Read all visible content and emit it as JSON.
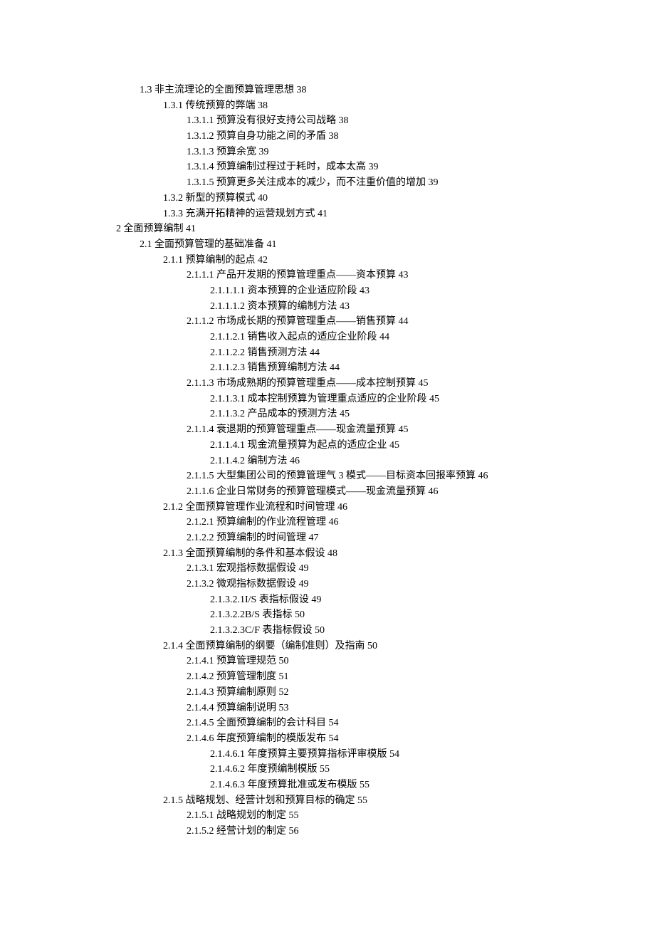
{
  "toc": [
    {
      "level": 0,
      "text": "1.3 非主流理论的全面预算管理思想 38"
    },
    {
      "level": 1,
      "text": "1.3.1 传统预算的弊端 38"
    },
    {
      "level": 2,
      "text": "1.3.1.1 预算没有很好支持公司战略 38"
    },
    {
      "level": 2,
      "text": "1.3.1.2 预算自身功能之间的矛盾 38"
    },
    {
      "level": 2,
      "text": "1.3.1.3 预算余宽 39"
    },
    {
      "level": 2,
      "text": "1.3.1.4 预算编制过程过于耗时，成本太高 39"
    },
    {
      "level": 2,
      "text": "1.3.1.5 预算更多关注成本的减少，而不注重价值的增加 39"
    },
    {
      "level": 1,
      "text": "1.3.2 新型的预算模式 40"
    },
    {
      "level": 1,
      "text": "1.3.3 充满开拓精神的运营规划方式 41"
    },
    {
      "level": -1,
      "text": "2 全面预算编制 41"
    },
    {
      "level": 0,
      "text": "2.1 全面预算管理的基础准备 41"
    },
    {
      "level": 1,
      "text": "2.1.1 预算编制的起点 42"
    },
    {
      "level": 2,
      "text": "2.1.1.1 产品开发期的预算管理重点——资本预算 43"
    },
    {
      "level": 3,
      "text": "2.1.1.1.1 资本预算的企业适应阶段 43"
    },
    {
      "level": 3,
      "text": "2.1.1.1.2 资本预算的编制方法 43"
    },
    {
      "level": 2,
      "text": "2.1.1.2 市场成长期的预算管理重点——销售预算 44"
    },
    {
      "level": 3,
      "text": "2.1.1.2.1 销售收入起点的适应企业阶段 44"
    },
    {
      "level": 3,
      "text": "2.1.1.2.2 销售预测方法 44"
    },
    {
      "level": 3,
      "text": "2.1.1.2.3 销售预算编制方法 44"
    },
    {
      "level": 2,
      "text": "2.1.1.3 市场成熟期的预算管理重点——成本控制预算 45"
    },
    {
      "level": 3,
      "text": "2.1.1.3.1 成本控制预算为管理重点适应的企业阶段 45"
    },
    {
      "level": 3,
      "text": "2.1.1.3.2 产品成本的预测方法 45"
    },
    {
      "level": 2,
      "text": "2.1.1.4 衰退期的预算管理重点——现金流量预算 45"
    },
    {
      "level": 3,
      "text": "2.1.1.4.1 现金流量预算为起点的适应企业 45"
    },
    {
      "level": 3,
      "text": "2.1.1.4.2 编制方法 46"
    },
    {
      "level": 2,
      "text": "2.1.1.5 大型集团公司的预算管理气 3 模式——目标资本回报率预算 46"
    },
    {
      "level": 2,
      "text": "2.1.1.6 企业日常财务的预算管理模式——现金流量预算 46"
    },
    {
      "level": 1,
      "text": "2.1.2 全面预算管理作业流程和时间管理 46"
    },
    {
      "level": 2,
      "text": "2.1.2.1 预算编制的作业流程管理 46"
    },
    {
      "level": 2,
      "text": "2.1.2.2 预算编制的时间管理 47"
    },
    {
      "level": 1,
      "text": "2.1.3 全面预算编制的条件和基本假设 48"
    },
    {
      "level": 2,
      "text": "2.1.3.1 宏观指标数据假设 49"
    },
    {
      "level": 2,
      "text": "2.1.3.2 微观指标数据假设 49"
    },
    {
      "level": 3,
      "text": "2.1.3.2.1I/S 表指标假设 49"
    },
    {
      "level": 3,
      "text": "2.1.3.2.2B/S 表指标 50"
    },
    {
      "level": 3,
      "text": "2.1.3.2.3C/F 表指标假设 50"
    },
    {
      "level": 1,
      "text": "2.1.4 全面预算编制的纲要（编制准则）及指南 50"
    },
    {
      "level": 2,
      "text": "2.1.4.1 预算管理规范 50"
    },
    {
      "level": 2,
      "text": "2.1.4.2 预算管理制度 51"
    },
    {
      "level": 2,
      "text": "2.1.4.3 预算编制原则 52"
    },
    {
      "level": 2,
      "text": "2.1.4.4 预算编制说明 53"
    },
    {
      "level": 2,
      "text": "2.1.4.5 全面预算编制的会计科目 54"
    },
    {
      "level": 2,
      "text": "2.1.4.6 年度预算编制的模版发布 54"
    },
    {
      "level": 3,
      "text": "2.1.4.6.1 年度预算主要预算指标评审模版 54"
    },
    {
      "level": 3,
      "text": "2.1.4.6.2 年度预编制模版 55"
    },
    {
      "level": 3,
      "text": "2.1.4.6.3 年度预算批准或发布模版 55"
    },
    {
      "level": 1,
      "text": "2.1.5 战略规划、经营计划和预算目标的确定 55"
    },
    {
      "level": 2,
      "text": "2.1.5.1 战略规划的制定 55"
    },
    {
      "level": 2,
      "text": "2.1.5.2 经营计划的制定 56"
    }
  ]
}
